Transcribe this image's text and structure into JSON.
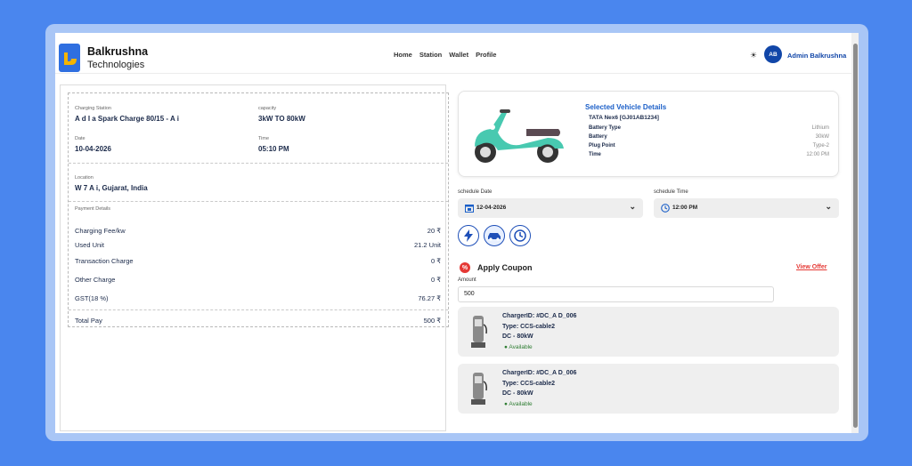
{
  "brand": {
    "name": "Balkrushna",
    "sub": "Technologies"
  },
  "nav": [
    "Home",
    "Station",
    "Wallet",
    "Profile"
  ],
  "user": {
    "initials": "AB",
    "name": "Admin Balkrushna"
  },
  "booking": {
    "station_label": "Charging Station",
    "station_value": "A      d I   a Spark Charge 80/15 - A    i",
    "capacity_label": "capacity",
    "capacity_value": "3kW TO 80kW",
    "date_label": "Date",
    "date_value": "10-04-2026",
    "time_label": "Time",
    "time_value": "05:10 PM",
    "location_label": "Location",
    "location_value": "W          7 A      i, Gujarat, India",
    "payment_label": "Payment Details",
    "payments": [
      {
        "label": "Charging Fee/kw",
        "value": "20 ₹"
      },
      {
        "label": "Used Unit",
        "value": "21.2 Unit"
      },
      {
        "label": "Transaction Charge",
        "value": "0 ₹"
      },
      {
        "label": "Other Charge",
        "value": "0 ₹"
      },
      {
        "label": "GST(18 %)",
        "value": "76.27 ₹"
      }
    ],
    "total_label": "Total Pay",
    "total_value": "500 ₹"
  },
  "vehicle": {
    "title": "Selected Vehicle Details",
    "model": "TATA Nex6 [GJ01AB1234]",
    "rows": [
      {
        "label": "Battery Type",
        "value": "Lithium"
      },
      {
        "label": "Battery",
        "value": "30kW"
      },
      {
        "label": "Plug Point",
        "value": "Type-2"
      },
      {
        "label": "Time",
        "value": "12:00 PM"
      }
    ]
  },
  "schedule": {
    "date_label": "schedule Date",
    "date_value": "12-04-2026",
    "time_label": "schedule Time",
    "time_value": "12:00 PM"
  },
  "coupon": {
    "title": "Apply Coupon",
    "view_offer": "View Offer",
    "amount_label": "Amount",
    "amount_value": "500"
  },
  "chargers": [
    {
      "id": "ChargerID: #DC_A        D_006",
      "type": "Type: CCS-cable2",
      "power": "DC - 80kW",
      "status": "Available"
    },
    {
      "id": "ChargerID: #DC_A        D_006",
      "type": "Type: CCS-cable2",
      "power": "DC - 80kW",
      "status": "Available"
    }
  ],
  "colors": {
    "background": "#4a86ee",
    "accent": "#1b5fc8",
    "danger": "#e53935",
    "scooter": "#48c9b0"
  }
}
